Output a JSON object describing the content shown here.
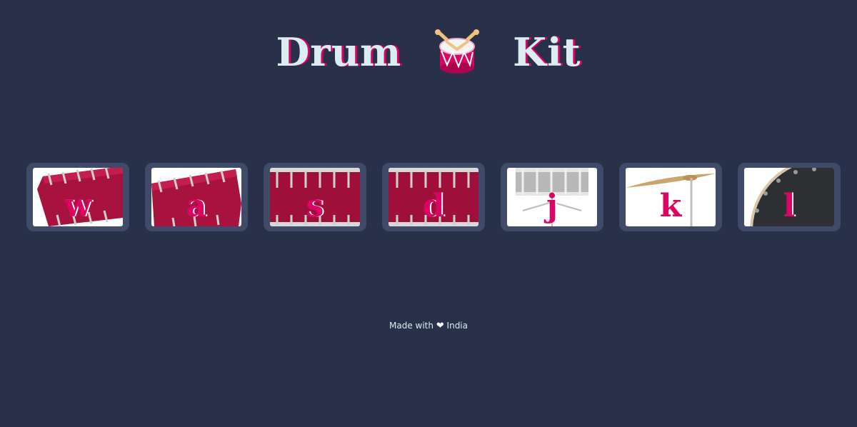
{
  "header": {
    "title_left": "Drum",
    "title_right": "Kit",
    "icon": "drum-icon"
  },
  "drums": [
    {
      "key": "w",
      "icon": "tom-tilted-icon"
    },
    {
      "key": "a",
      "icon": "tom-tilted-icon"
    },
    {
      "key": "s",
      "icon": "floor-tom-icon"
    },
    {
      "key": "d",
      "icon": "floor-tom-icon"
    },
    {
      "key": "j",
      "icon": "snare-icon"
    },
    {
      "key": "k",
      "icon": "cymbal-icon"
    },
    {
      "key": "l",
      "icon": "bass-drum-icon"
    }
  ],
  "footer": {
    "prefix": "Made with",
    "heart": "❤",
    "suffix": "India"
  },
  "colors": {
    "background": "#283149",
    "tile": "#404b69",
    "accent": "#da0463",
    "title": "#dbedf3"
  }
}
